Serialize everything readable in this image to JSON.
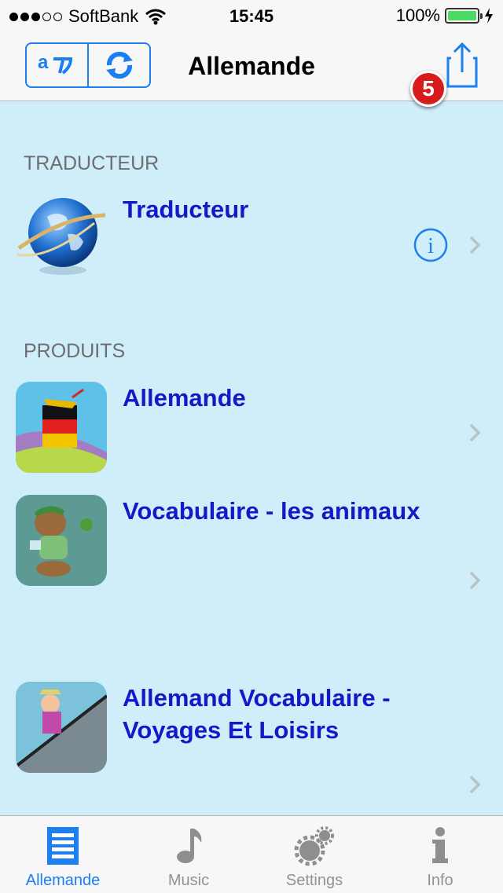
{
  "status_bar": {
    "carrier": "SoftBank",
    "time": "15:45",
    "battery": "100%"
  },
  "nav": {
    "title": "Allemande",
    "badge_count": "5"
  },
  "sections": {
    "translator_header": "TRADUCTEUR",
    "products_header": "PRODUITS"
  },
  "rows": {
    "translator": "Traducteur",
    "product1": "Allemande",
    "product2": "Vocabulaire - les animaux",
    "product3_line1": "Allemand Vocabulaire -",
    "product3_line2": "Voyages Et Loisirs"
  },
  "tabs": [
    {
      "label": "Allemande"
    },
    {
      "label": "Music"
    },
    {
      "label": "Settings"
    },
    {
      "label": "Info"
    }
  ],
  "colors": {
    "accent": "#1a7ff0",
    "link_text": "#1717c8",
    "background": "#cfeefa",
    "badge": "#d81b1b"
  }
}
